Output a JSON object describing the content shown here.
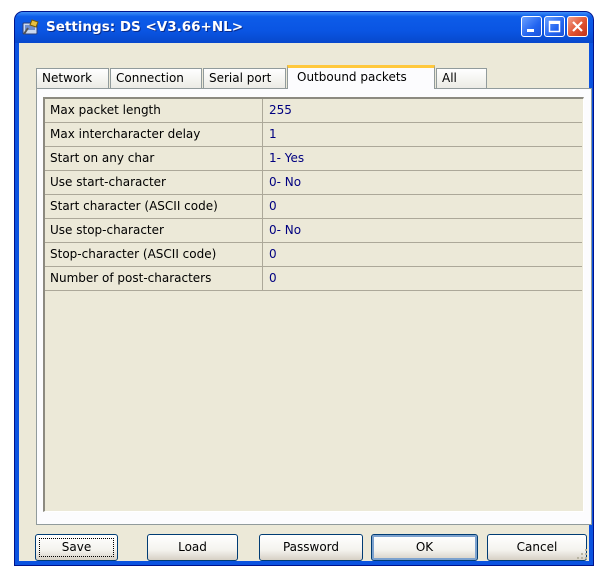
{
  "window": {
    "title": "Settings: DS <V3.66+NL>",
    "icon": "settings-app-icon",
    "controls": [
      "minimize-icon",
      "maximize-icon",
      "close-icon"
    ],
    "colors": {
      "titlebar": "#0a55e3",
      "client": "#ece9d8",
      "tab_highlight": "#ffc83c",
      "value_text": "#000080"
    }
  },
  "tabs": [
    {
      "label": "Network",
      "active": false
    },
    {
      "label": "Connection",
      "active": false
    },
    {
      "label": "Serial port",
      "active": false
    },
    {
      "label": "Outbound packets",
      "active": true
    },
    {
      "label": "All",
      "active": false
    }
  ],
  "settings": [
    {
      "name": "Max packet length",
      "value": "255"
    },
    {
      "name": "Max intercharacter delay",
      "value": "1"
    },
    {
      "name": "Start on any char",
      "value": "1- Yes"
    },
    {
      "name": "Use start-character",
      "value": "0- No"
    },
    {
      "name": "Start character (ASCII code)",
      "value": "0"
    },
    {
      "name": "Use stop-character",
      "value": "0- No"
    },
    {
      "name": "Stop-character (ASCII code)",
      "value": "0"
    },
    {
      "name": "Number of post-characters",
      "value": "0"
    }
  ],
  "buttons": {
    "save": "Save",
    "load": "Load",
    "password": "Password",
    "ok": "OK",
    "cancel": "Cancel"
  }
}
